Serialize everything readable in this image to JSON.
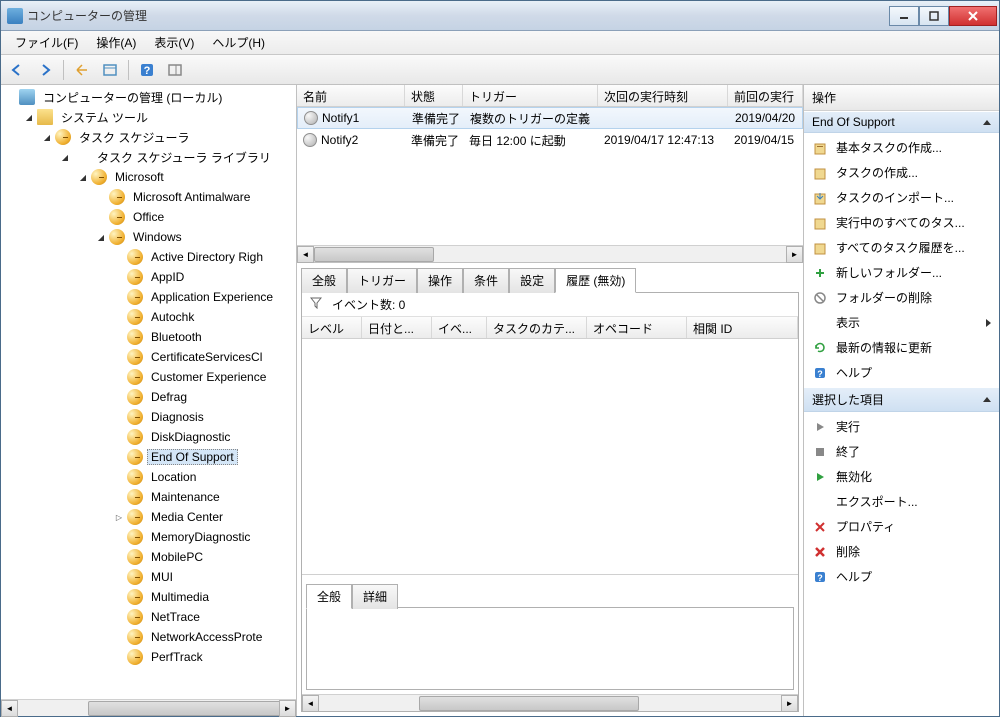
{
  "window": {
    "title": "コンピューターの管理"
  },
  "menu": {
    "file": "ファイル(F)",
    "action": "操作(A)",
    "view": "表示(V)",
    "help": "ヘルプ(H)"
  },
  "tree": {
    "root": "コンピューターの管理 (ローカル)",
    "sys_tools": "システム ツール",
    "task_sched": "タスク スケジューラ",
    "task_lib": "タスク スケジューラ ライブラリ",
    "microsoft": "Microsoft",
    "ms_antimalware": "Microsoft Antimalware",
    "office": "Office",
    "windows": "Windows",
    "nodes": [
      "Active Directory Righ",
      "AppID",
      "Application Experience",
      "Autochk",
      "Bluetooth",
      "CertificateServicesCl",
      "Customer Experience",
      "Defrag",
      "Diagnosis",
      "DiskDiagnostic",
      "End Of Support",
      "Location",
      "Maintenance",
      "Media Center",
      "MemoryDiagnostic",
      "MobilePC",
      "MUI",
      "Multimedia",
      "NetTrace",
      "NetworkAccessProte",
      "PerfTrack"
    ],
    "selected_index": 10,
    "expandable": {
      "13": true
    }
  },
  "task_columns": {
    "name": "名前",
    "status": "状態",
    "trigger": "トリガー",
    "next_run": "次回の実行時刻",
    "last_run": "前回の実行"
  },
  "tasks": [
    {
      "name": "Notify1",
      "status": "準備完了",
      "trigger": "複数のトリガーの定義",
      "next_run": "",
      "last_run": "2019/04/20"
    },
    {
      "name": "Notify2",
      "status": "準備完了",
      "trigger": "毎日 12:00 に起動",
      "next_run": "2019/04/17 12:47:13",
      "last_run": "2019/04/15"
    }
  ],
  "detail_tabs": {
    "general": "全般",
    "triggers": "トリガー",
    "actions": "操作",
    "conditions": "条件",
    "settings": "設定",
    "history": "履歴 (無効)"
  },
  "history": {
    "filter_label": "イベント数: 0",
    "cols": {
      "level": "レベル",
      "date": "日付と...",
      "event": "イベ...",
      "category": "タスクのカテ...",
      "opcode": "オペコード",
      "corr": "相関 ID"
    }
  },
  "bottom_tabs": {
    "general": "全般",
    "detail": "詳細"
  },
  "actions": {
    "title": "操作",
    "section1": "End Of Support",
    "items1": [
      "基本タスクの作成...",
      "タスクの作成...",
      "タスクのインポート...",
      "実行中のすべてのタス...",
      "すべてのタスク履歴を...",
      "新しいフォルダー...",
      "フォルダーの削除",
      "表示",
      "最新の情報に更新",
      "ヘルプ"
    ],
    "section2": "選択した項目",
    "items2": [
      "実行",
      "終了",
      "無効化",
      "エクスポート...",
      "プロパティ",
      "削除",
      "ヘルプ"
    ]
  }
}
